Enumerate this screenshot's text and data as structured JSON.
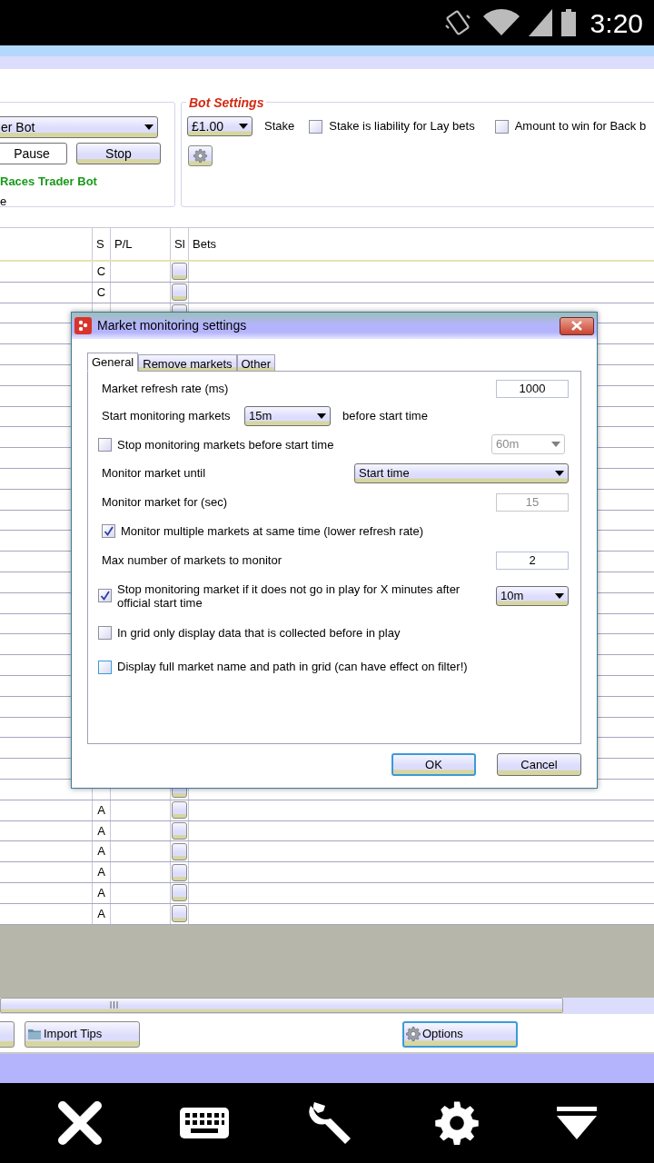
{
  "status_bar": {
    "time": "3:20"
  },
  "bot_panel": {
    "bot_dropdown": "er Bot",
    "buttons": [
      "Pause",
      "Stop"
    ],
    "bot_name": "Races Trader Bot",
    "status_text": "e"
  },
  "bot_settings": {
    "title": "Bot Settings",
    "stake": "£1.00",
    "stake_label": "Stake",
    "options": [
      {
        "label": "Stake is liability for Lay bets",
        "checked": false
      },
      {
        "label": "Amount to win for Back b",
        "checked": false
      }
    ]
  },
  "table": {
    "columns": [
      "S",
      "P/L",
      "Sl",
      "Bets"
    ],
    "top_rows": [
      {
        "status": "C"
      },
      {
        "status": "C"
      }
    ],
    "bottom_rows": [
      {
        "status": "A"
      },
      {
        "status": "A"
      },
      {
        "status": "A"
      },
      {
        "status": "A"
      },
      {
        "status": "A"
      },
      {
        "status": "A"
      }
    ]
  },
  "toolbar": {
    "buttons": [
      {
        "label": "Import Tips",
        "kind": "folder",
        "focused": false
      },
      {
        "label": "Options",
        "kind": "gear",
        "focused": true
      }
    ]
  },
  "dialog": {
    "title": "Market monitoring settings",
    "tabs": [
      {
        "label": "General",
        "selected": true
      },
      {
        "label": "Remove markets",
        "selected": false
      },
      {
        "label": "Other",
        "selected": false
      }
    ],
    "rows": [
      {
        "kind": "field",
        "label": "Market refresh rate (ms)",
        "value": "1000",
        "disabled": false
      },
      {
        "kind": "dropdown_inline",
        "label": "Start monitoring markets",
        "value": "15m",
        "suffix": "before start time"
      },
      {
        "kind": "check_dropdown",
        "label": "Stop monitoring markets before start time",
        "checked": false,
        "value": "60m",
        "disabled": true
      },
      {
        "kind": "dropdown",
        "label": "Monitor market until",
        "value": "Start time"
      },
      {
        "kind": "field",
        "label": "Monitor market for (sec)",
        "value": "15",
        "disabled": true
      },
      {
        "kind": "check",
        "label": "Monitor multiple markets at same time (lower refresh rate)",
        "checked": true
      },
      {
        "kind": "field",
        "label": "Max number of markets to monitor",
        "value": "2",
        "disabled": false
      },
      {
        "kind": "check_dropdown",
        "label": "Stop monitoring market if it does not go in play for X minutes after official start time",
        "checked": true,
        "value": "10m",
        "disabled": false
      },
      {
        "kind": "check",
        "label": "In grid only display data that is collected before in play",
        "checked": false
      },
      {
        "kind": "check",
        "label": "Display full market name and path in grid (can have effect on filter!)",
        "checked": false
      }
    ],
    "buttons": [
      {
        "label": "OK",
        "focused": true
      },
      {
        "label": "Cancel",
        "focused": false
      }
    ]
  }
}
